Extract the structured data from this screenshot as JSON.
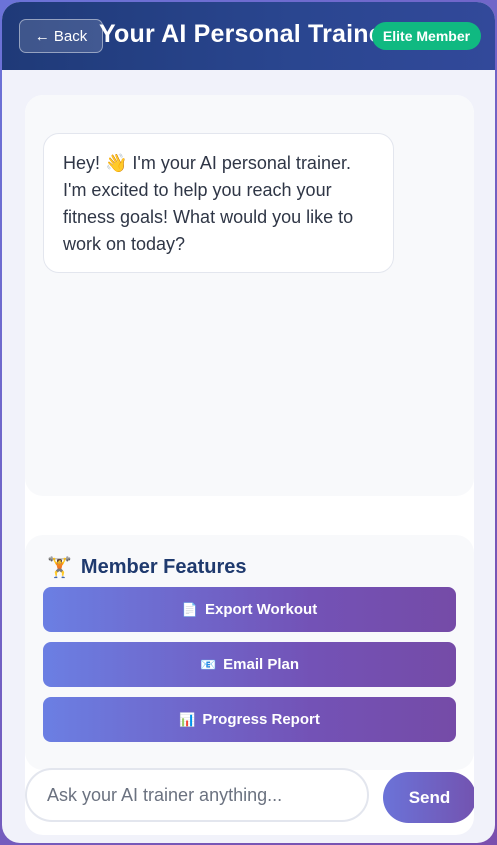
{
  "header": {
    "back_label": "← Back",
    "title": "Your AI Personal Trainer",
    "badge": "Elite Member"
  },
  "chat": {
    "messages": [
      {
        "sender": "trainer",
        "text": "Hey! 👋 I'm your AI personal trainer. I'm excited to help you reach your fitness goals! What would you like to work on today?"
      }
    ]
  },
  "features": {
    "icon": "🏋️",
    "title": "Member Features",
    "buttons": [
      {
        "icon": "📄",
        "label": "Export Workout"
      },
      {
        "icon": "📧",
        "label": "Email Plan"
      },
      {
        "icon": "📊",
        "label": "Progress Report"
      }
    ]
  },
  "composer": {
    "placeholder": "Ask your AI trainer anything...",
    "send_label": "Send"
  },
  "colors": {
    "header": "#1f3a78",
    "badge": "#10b981",
    "accent_start": "#6b73d8",
    "accent_end": "#764ba2"
  }
}
